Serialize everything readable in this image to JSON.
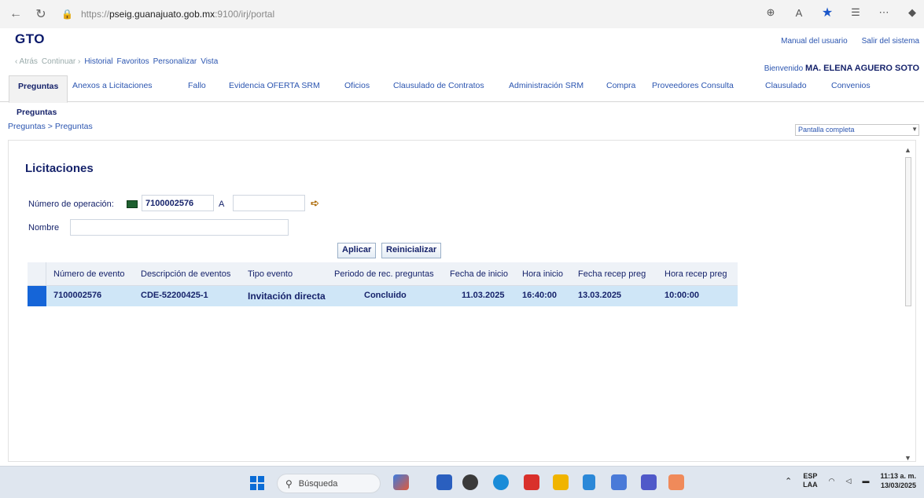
{
  "browser": {
    "url_scheme": "https://",
    "url_host": "pseig.guanajuato.gob.mx",
    "url_rest": ":9100/irj/portal"
  },
  "portal": {
    "logo": "GTO",
    "top_links": [
      "Manual del usuario",
      "Salir del sistema"
    ],
    "history": {
      "back": "‹ Atrás",
      "forward": "Continuar ›",
      "items": [
        "Historial",
        "Favoritos",
        "Personalizar",
        "Vista"
      ]
    },
    "welcome_label": "Bienvenido",
    "welcome_user": "MA. ELENA AGUERO SOTO"
  },
  "tabs": [
    "Preguntas",
    "Anexos a Licitaciones",
    "Fallo",
    "Evidencia OFERTA SRM",
    "Oficios",
    "Clausulado de Contratos",
    "Administración SRM",
    "Compra",
    "Proveedores Consulta",
    "Clausulado",
    "Convenios"
  ],
  "subtab": "Preguntas",
  "breadcrumb": "Preguntas  >  Preguntas",
  "view_select": "Pantalla completa",
  "section": {
    "title": "Licitaciones",
    "op_label": "Número de operación:",
    "op_value": "7100002576",
    "op_to_label": "A",
    "op_to_value": "",
    "name_label": "Nombre",
    "name_value": "",
    "apply_label": "Aplicar",
    "reset_label": "Reinicializar"
  },
  "table": {
    "columns": [
      "Número de evento",
      "Descripción de eventos",
      "Tipo evento",
      "Periodo de rec. preguntas",
      "Fecha de inicio",
      "Hora inicio",
      "Fecha recep preg",
      "Hora recep preg"
    ],
    "rows": [
      [
        "7100002576",
        "CDE-52200425-1",
        "Invitación directa",
        "Concluido",
        "11.03.2025",
        "16:40:00",
        "13.03.2025",
        "10:00:00"
      ]
    ]
  },
  "taskbar": {
    "search_placeholder": "Búsqueda",
    "lang_top": "ESP",
    "lang_bottom": "LAA",
    "time": "11:13 a. m.",
    "date": "13/03/2025"
  },
  "colors": {
    "accent_blue": "#16236b",
    "link_blue": "#2b55b0",
    "row_selected": "#cfe6f7",
    "row_selector": "#1565d8"
  }
}
